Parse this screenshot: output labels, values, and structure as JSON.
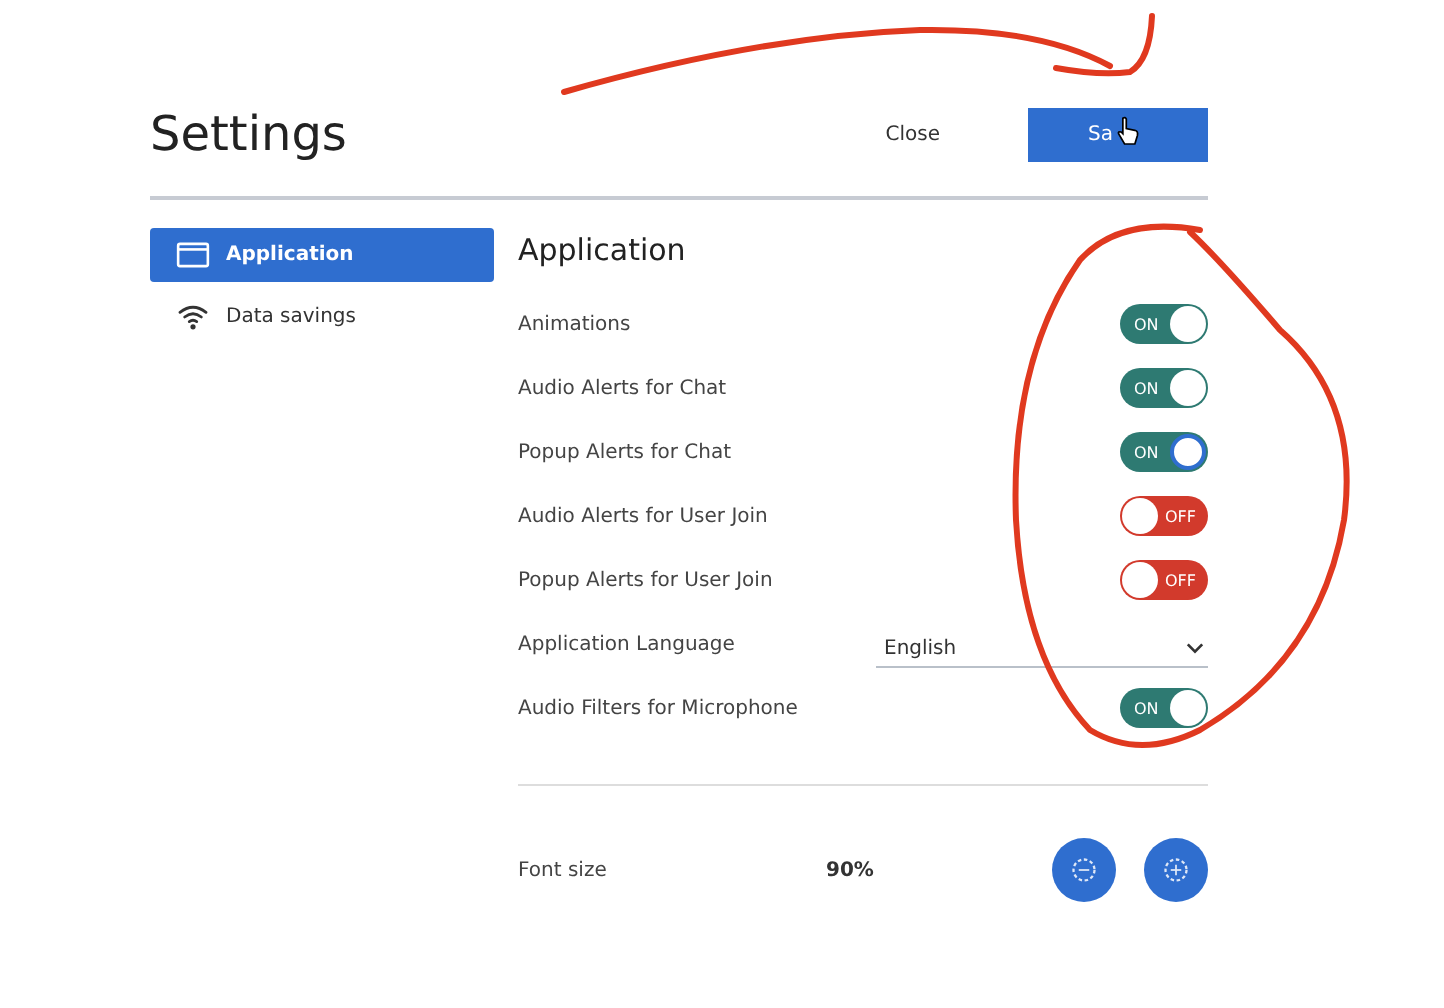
{
  "header": {
    "title": "Settings",
    "close_label": "Close",
    "save_label": "Sa"
  },
  "sidebar": {
    "items": [
      {
        "label": "Application",
        "selected": true
      },
      {
        "label": "Data savings",
        "selected": false
      }
    ]
  },
  "section": {
    "title": "Application",
    "rows": [
      {
        "kind": "toggle",
        "label": "Animations",
        "on": true,
        "text": "ON",
        "focused": false
      },
      {
        "kind": "toggle",
        "label": "Audio Alerts for Chat",
        "on": true,
        "text": "ON",
        "focused": false
      },
      {
        "kind": "toggle",
        "label": "Popup Alerts for Chat",
        "on": true,
        "text": "ON",
        "focused": true
      },
      {
        "kind": "toggle",
        "label": "Audio Alerts for User Join",
        "on": false,
        "text": "OFF",
        "focused": false
      },
      {
        "kind": "toggle",
        "label": "Popup Alerts for User Join",
        "on": false,
        "text": "OFF",
        "focused": false
      },
      {
        "kind": "select",
        "label": "Application Language",
        "value": "English"
      },
      {
        "kind": "toggle",
        "label": "Audio Filters for Microphone",
        "on": true,
        "text": "ON",
        "focused": false
      }
    ]
  },
  "font_size": {
    "label": "Font size",
    "value": "90%"
  }
}
